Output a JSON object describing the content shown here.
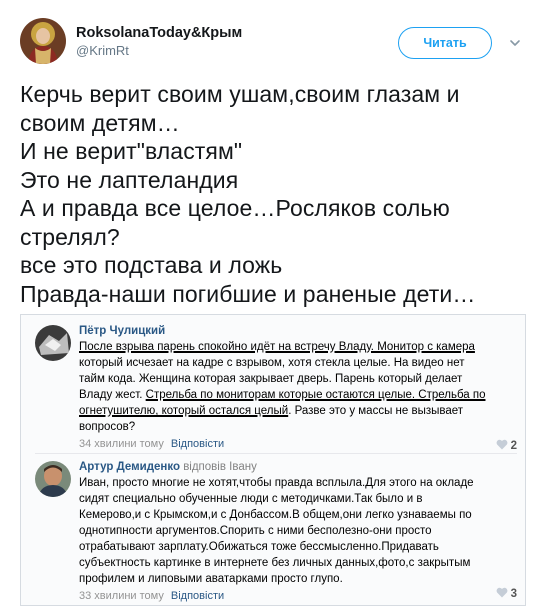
{
  "account": {
    "display_name": "RoksolanaToday&Крым",
    "handle": "@KrimRt",
    "follow_label": "Читать"
  },
  "tweet": {
    "lines": [
      "Керчь верит своим ушам,своим глазам и",
      "своим детям…",
      "И не верит\"властям\"",
      "Это не лаптеландия",
      "А и правда все целое…Росляков солью",
      "стрелял?",
      "все это подстава и ложь",
      "Правда-наши погибшие и раненые дети…"
    ]
  },
  "embedded": {
    "comment1": {
      "author": "Пётр Чулицкий",
      "lines": [
        "После взрыва парень спокойно идёт на встречу Владу. Монитор с камера",
        "который исчезает на кадре с взрывом, хотя стекла целые. На видео нет",
        "тайм кода. Женщина которая закрывает дверь. Парень который делает",
        "Владу жест. ",
        "Стрельба по мониторам которые остаются целые. Стрельба по",
        "огнетушителю, который остался целый",
        ". Разве это у массы не вызывает",
        "вопросов?"
      ],
      "time": "34 хвилини тому",
      "reply_label": "Відповісти",
      "likes": "2"
    },
    "comment2": {
      "author": "Артур Демиденко",
      "replied_to": "відповів Івану",
      "lines": [
        "Иван, просто многие не хотят,чтобы правда всплыла.Для этого на окладе",
        "сидят специально обученные люди с методичками.Так было и в",
        "Кемерово,и с Крымском,и с Донбассом.В общем,они легко узнаваемы по",
        "однотипности аргументов.Спорить с ними бесполезно-они просто",
        "отрабатывают зарплату.Обижаться тоже бессмысленно.Придавать",
        "субъектность картинке в интернете без личных данных,фото,с закрытым",
        "профилем и липовыми аватарками просто глупо."
      ],
      "time": "33 хвилини тому",
      "reply_label": "Відповісти",
      "likes": "3"
    }
  },
  "colors": {
    "twitter_blue": "#1da1f2",
    "vk_link": "#2a5885",
    "muted": "#657786"
  },
  "icons": [
    "avatar-portrait",
    "chevron-down-icon",
    "heart-icon"
  ]
}
